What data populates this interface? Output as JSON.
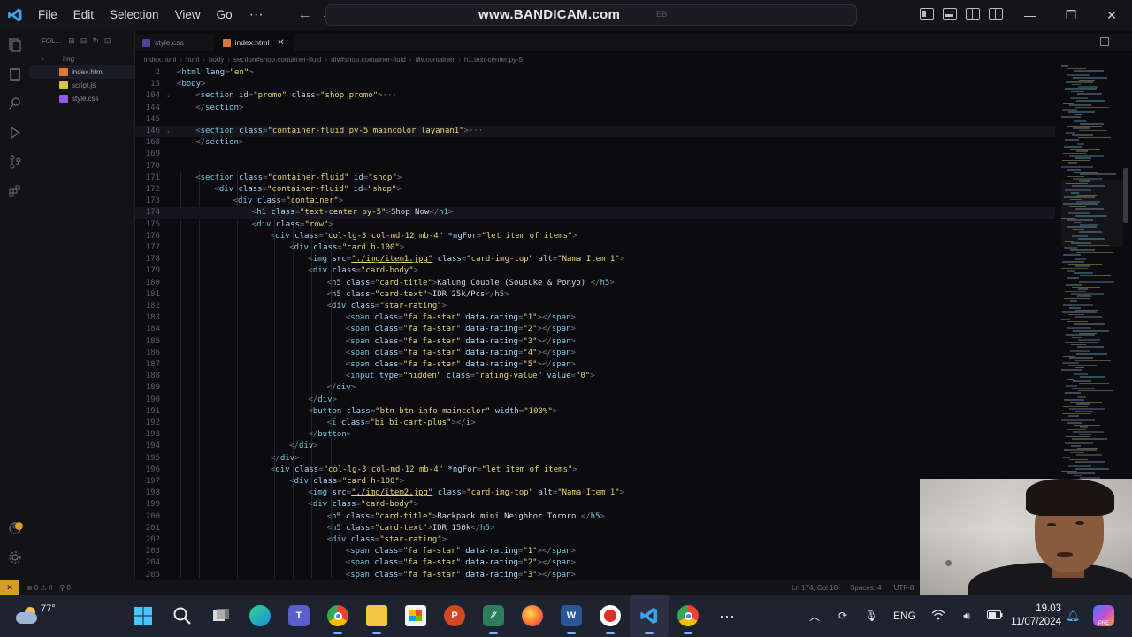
{
  "titlebar": {
    "menus": [
      "File",
      "Edit",
      "Selection",
      "View",
      "Go"
    ],
    "more": "···",
    "watermark": "www.BANDICAM.com",
    "watermark_faded": "EB"
  },
  "sidebar": {
    "header": "FOL...",
    "items": [
      {
        "name": "img",
        "type": "folder"
      },
      {
        "name": "index.html",
        "type": "html",
        "active": true
      },
      {
        "name": "script.js",
        "type": "js"
      },
      {
        "name": "style.css",
        "type": "css"
      }
    ]
  },
  "tabs": [
    {
      "label": "style.css",
      "active": false
    },
    {
      "label": "index.html",
      "active": true
    }
  ],
  "breadcrumb": [
    "index.html",
    "html",
    "body",
    "section#shop.container-fluid",
    "div#shop.container-fluid",
    "div.container",
    "h1.text-center.py-5"
  ],
  "code_lines": [
    {
      "n": "2",
      "t": "<html lang=\"en\">",
      "indent": 0
    },
    {
      "n": "15",
      "t": "<body>",
      "indent": 0
    },
    {
      "n": "104",
      "t": "<section id=\"promo\" class=\"shop promo\">···",
      "indent": 1,
      "fold": ">"
    },
    {
      "n": "144",
      "t": "</section>",
      "indent": 1
    },
    {
      "n": "145",
      "t": "",
      "indent": 0
    },
    {
      "n": "146",
      "t": "<section class=\"container-fluid py-5 maincolor layanan1\">···",
      "indent": 1,
      "fold": ">",
      "hl": true
    },
    {
      "n": "168",
      "t": "</section>",
      "indent": 1
    },
    {
      "n": "169",
      "t": "",
      "indent": 0
    },
    {
      "n": "170",
      "t": "",
      "indent": 0
    },
    {
      "n": "171",
      "t": "<section class=\"container-fluid\" id=\"shop\">",
      "indent": 1
    },
    {
      "n": "172",
      "t": "<div class=\"container-fluid\" id=\"shop\">",
      "indent": 2
    },
    {
      "n": "173",
      "t": "<div class=\"container\">",
      "indent": 3
    },
    {
      "n": "174",
      "t": "<h1 class=\"text-center py-5\">Shop Now</h1>",
      "indent": 4,
      "hl": true
    },
    {
      "n": "175",
      "t": "<div class=\"row\">",
      "indent": 4
    },
    {
      "n": "176",
      "t": "<div class=\"col-lg-3 col-md-12 mb-4\" *ngFor=\"let item of items\">",
      "indent": 5
    },
    {
      "n": "177",
      "t": "<div class=\"card h-100\">",
      "indent": 6
    },
    {
      "n": "178",
      "t": "<img src=\"./img/item1.jpg\" class=\"card-img-top\" alt=\"Nama Item 1\">",
      "indent": 7
    },
    {
      "n": "179",
      "t": "<div class=\"card-body\">",
      "indent": 7
    },
    {
      "n": "180",
      "t": "<h5 class=\"card-title\">Kalung Couple (Sousuke & Ponyo) </h5>",
      "indent": 8
    },
    {
      "n": "181",
      "t": "<h5 class=\"card-text\">IDR 25k/Pcs</h5>",
      "indent": 8
    },
    {
      "n": "182",
      "t": "<div class=\"star-rating\">",
      "indent": 8
    },
    {
      "n": "183",
      "t": "<span class=\"fa fa-star\" data-rating=\"1\"></span>",
      "indent": 9
    },
    {
      "n": "184",
      "t": "<span class=\"fa fa-star\" data-rating=\"2\"></span>",
      "indent": 9
    },
    {
      "n": "185",
      "t": "<span class=\"fa fa-star\" data-rating=\"3\"></span>",
      "indent": 9
    },
    {
      "n": "186",
      "t": "<span class=\"fa fa-star\" data-rating=\"4\"></span>",
      "indent": 9
    },
    {
      "n": "187",
      "t": "<span class=\"fa fa-star\" data-rating=\"5\"></span>",
      "indent": 9
    },
    {
      "n": "188",
      "t": "<input type=\"hidden\" class=\"rating-value\" value=\"0\">",
      "indent": 9
    },
    {
      "n": "189",
      "t": "</div>",
      "indent": 8
    },
    {
      "n": "190",
      "t": "</div>",
      "indent": 7
    },
    {
      "n": "191",
      "t": "<button class=\"btn btn-info maincolor\" width=\"100%\">",
      "indent": 7
    },
    {
      "n": "192",
      "t": "<i class=\"bi bi-cart-plus\"></i>",
      "indent": 8
    },
    {
      "n": "193",
      "t": "</button>",
      "indent": 7
    },
    {
      "n": "194",
      "t": "</div>",
      "indent": 6
    },
    {
      "n": "195",
      "t": "</div>",
      "indent": 5
    },
    {
      "n": "196",
      "t": "<div class=\"col-lg-3 col-md-12 mb-4\" *ngFor=\"let item of items\">",
      "indent": 5
    },
    {
      "n": "197",
      "t": "<div class=\"card h-100\">",
      "indent": 6
    },
    {
      "n": "198",
      "t": "<img src=\"./img/item2.jpg\" class=\"card-img-top\" alt=\"Nama Item 1\">",
      "indent": 7
    },
    {
      "n": "199",
      "t": "<div class=\"card-body\">",
      "indent": 7
    },
    {
      "n": "200",
      "t": "<h5 class=\"card-title\">Backpack mini Neighbor Tororo </h5>",
      "indent": 8
    },
    {
      "n": "201",
      "t": "<h5 class=\"card-text\">IDR 150k</h5>",
      "indent": 8
    },
    {
      "n": "202",
      "t": "<div class=\"star-rating\">",
      "indent": 8
    },
    {
      "n": "203",
      "t": "<span class=\"fa fa-star\" data-rating=\"1\"></span>",
      "indent": 9
    },
    {
      "n": "204",
      "t": "<span class=\"fa fa-star\" data-rating=\"2\"></span>",
      "indent": 9
    },
    {
      "n": "205",
      "t": "<span class=\"fa fa-star\" data-rating=\"3\"></span>",
      "indent": 9
    }
  ],
  "statusbar": {
    "problems": "⊗ 0 ⚠ 0",
    "ports": "⚲ 0",
    "position": "Ln 174, Col 18",
    "spaces": "Spaces: 4",
    "encoding": "UTF-8"
  },
  "taskbar": {
    "temperature": "77°",
    "language": "ENG",
    "time": "19.03",
    "date": "11/07/2024",
    "apps": [
      "start",
      "search",
      "task-view",
      "edge",
      "teams",
      "chrome",
      "file-explorer",
      "store",
      "powerpoint",
      "vscode-insiders",
      "firefox",
      "word",
      "recorder",
      "vscode",
      "chrome-profile",
      "more"
    ]
  },
  "colors": {
    "tag": "#7ac6e0",
    "attr_name": "#aad7f5",
    "attr_value": "#e6d37a",
    "remote": "#d69c2a"
  }
}
